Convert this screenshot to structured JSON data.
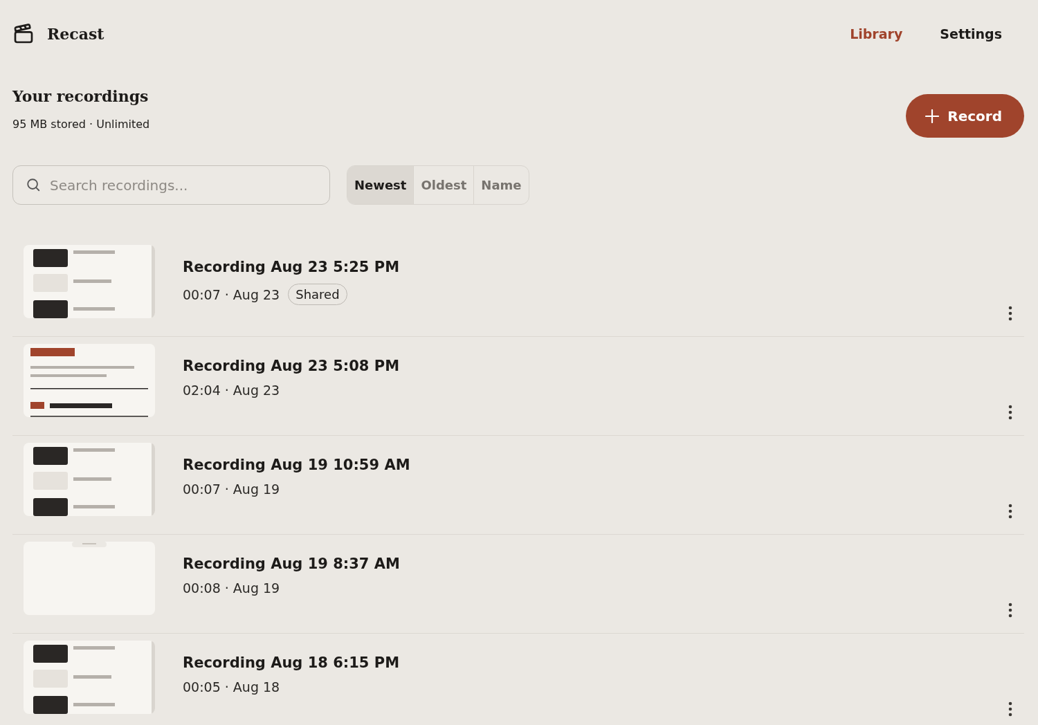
{
  "app": {
    "name": "Recast"
  },
  "nav": [
    {
      "label": "Library",
      "selected": true
    },
    {
      "label": "Settings",
      "selected": false
    }
  ],
  "header": {
    "title": "Your recordings",
    "subtitle": "95 MB stored · Unlimited"
  },
  "record_button": {
    "label": "Record"
  },
  "search": {
    "placeholder": "Search recordings..."
  },
  "sort": [
    {
      "label": "Newest",
      "selected": true
    },
    {
      "label": "Oldest",
      "selected": false
    },
    {
      "label": "Name",
      "selected": false
    }
  ],
  "recordings": [
    {
      "title": "Recording Aug 23 5:25 PM",
      "meta": "00:07 · Aug 23",
      "badge": "Shared"
    },
    {
      "title": "Recording Aug 23 5:08 PM",
      "meta": "02:04 · Aug 23"
    },
    {
      "title": "Recording Aug 19 10:59 AM",
      "meta": "00:07 · Aug 19"
    },
    {
      "title": "Recording Aug 19 8:37 AM",
      "meta": "00:08 · Aug 19"
    },
    {
      "title": "Recording Aug 18 6:15 PM",
      "meta": "00:05 · Aug 18"
    }
  ]
}
